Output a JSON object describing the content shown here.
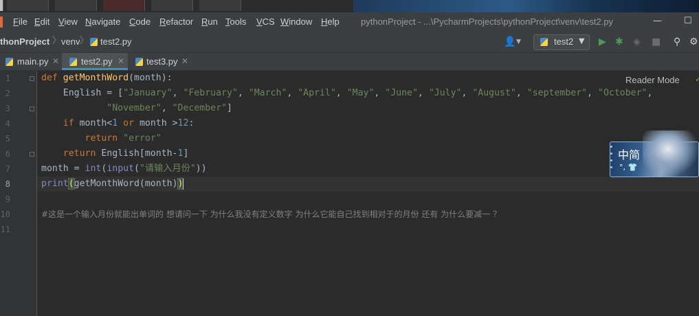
{
  "menu": {
    "items": [
      "File",
      "Edit",
      "View",
      "Navigate",
      "Code",
      "Refactor",
      "Run",
      "Tools",
      "VCS",
      "Window",
      "Help"
    ],
    "window_title": "pythonProject - ...\\PycharmProjects\\pythonProject\\venv\\test2.py"
  },
  "window_controls": {
    "minimize": "—",
    "maximize": "☐"
  },
  "navbar": {
    "project": "thonProject",
    "folder": "venv",
    "file": "test2.py",
    "separator": "〉",
    "run_config": "test2",
    "icons": [
      "user-icon",
      "run-icon",
      "debug-icon",
      "coverage-icon",
      "stop-icon",
      "search-icon",
      "settings-icon"
    ]
  },
  "tabs": [
    {
      "label": "main.py",
      "active": false
    },
    {
      "label": "test2.py",
      "active": true
    },
    {
      "label": "test3.py",
      "active": false
    }
  ],
  "editor": {
    "reader_mode": "Reader Mode",
    "line_numbers": [
      "1",
      "2",
      "3",
      "4",
      "5",
      "6",
      "7",
      "8",
      "9",
      "10",
      "11"
    ],
    "current_line": "8",
    "code": {
      "l1_def": "def",
      "l1_name": "getMonthWord",
      "l1_rest": "(month):",
      "l2_a": "    English = [",
      "l2_s": [
        "\"January\"",
        "\"February\"",
        "\"March\"",
        "\"April\"",
        "\"May\"",
        "\"June\"",
        "\"July\"",
        "\"August\"",
        "\"september\"",
        "\"October\""
      ],
      "l3_s": [
        "\"November\"",
        "\"December\""
      ],
      "l4_if": "if",
      "l4_a": " month<",
      "l4_n1": "1",
      "l4_or": " or",
      "l4_b": " month >",
      "l4_n2": "12",
      "l4_c": ":",
      "l5_ret": "return",
      "l5_str": "\"error\"",
      "l6_ret": "return",
      "l6_a": " English[month-",
      "l6_n": "1",
      "l6_b": "]",
      "l7_a": "month = ",
      "l7_int": "int",
      "l7_b": "(",
      "l7_input": "input",
      "l7_c": "(",
      "l7_str": "\"请输入月份\"",
      "l7_d": "))",
      "l8_print": "print",
      "l8_open": "(",
      "l8_mid": "getMonthWord(month)",
      "l8_close": ")",
      "l10_comment": "#这是一个输入月份就能出单词的 想请问一下 为什么我没有定义数字 为什么它能自己找到相对于的月份 还有 为什么要减一 ？"
    }
  },
  "ime": {
    "label": "中简",
    "sub": "°, 👕"
  }
}
